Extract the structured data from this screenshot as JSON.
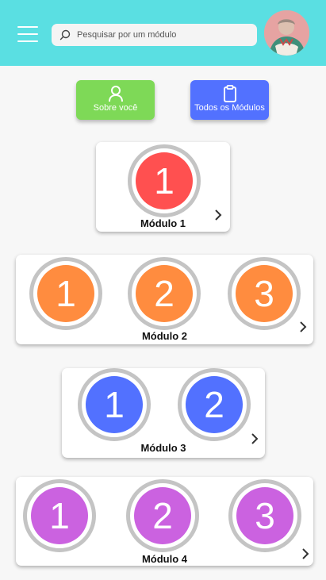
{
  "search": {
    "placeholder": "Pesquisar por um módulo"
  },
  "buttons": {
    "about": "Sobre você",
    "modules": "Todos os Módulos"
  },
  "colors": {
    "appbar": "#5adfe2",
    "about_button": "#7ed957",
    "modules_button": "#5271ff",
    "module1": "#ff5050",
    "module2": "#ff8c3f",
    "module3": "#5271ff",
    "module4": "#cb62e0"
  },
  "modules": [
    {
      "title": "Módulo 1",
      "lessons": [
        "1"
      ]
    },
    {
      "title": "Módulo 2",
      "lessons": [
        "1",
        "2",
        "3"
      ]
    },
    {
      "title": "Módulo 3",
      "lessons": [
        "1",
        "2"
      ]
    },
    {
      "title": "Módulo 4",
      "lessons": [
        "1",
        "2",
        "3"
      ]
    }
  ]
}
